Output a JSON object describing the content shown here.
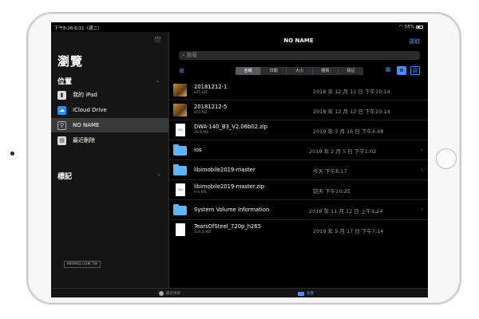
{
  "status": {
    "time": "下午8:26  6/11（週二）",
    "battery": "55%"
  },
  "sidebar": {
    "title": "瀏覽",
    "locations_label": "位置",
    "tags_label": "標記",
    "items": [
      {
        "label": "我的 iPad",
        "icon": "ipad-icon"
      },
      {
        "label": "iCloud Drive",
        "icon": "icloud-icon"
      },
      {
        "label": "NO NAME",
        "icon": "usb-icon"
      },
      {
        "label": "最近刪除",
        "icon": "trash-icon"
      }
    ],
    "watermark": "MRMAD.COM.TW"
  },
  "main": {
    "title": "NO NAME",
    "select_label": "選取",
    "search_placeholder": "搜尋",
    "sort_options": [
      "名稱",
      "日期",
      "大小",
      "種類",
      "標記"
    ],
    "files": [
      {
        "name": "20181212-1",
        "size": "845 KB",
        "date": "2018 年 12 月 12 日 下午10:14",
        "type": "img"
      },
      {
        "name": "20181212-5",
        "size": "855 KB",
        "date": "2018 年 12 月 12 日 下午10:14",
        "type": "img"
      },
      {
        "name": "DWA-140_B3_V2.06b02.zip",
        "size": "28.8 MB",
        "date": "2019 年 3 月 16 日 下午4:48",
        "type": "zip"
      },
      {
        "name": "ios",
        "size": "",
        "date": "2019 年 2 月 5 日 下午1:02",
        "type": "folder"
      },
      {
        "name": "libimobile2019-master",
        "size": "",
        "date": "今天 下午8:17",
        "type": "folder"
      },
      {
        "name": "libimobile2019-master.zip",
        "size": "9.6 MB",
        "date": "前天 下午10:25",
        "type": "zip"
      },
      {
        "name": "System Volume Information",
        "size": "",
        "date": "2018 年 11 月 12 日 上午9:24",
        "type": "folder"
      },
      {
        "name": "TearsOfSteel_720p_h265",
        "size": "105.8 MB",
        "date": "2019 年 5 月 17 日 下午7:14",
        "type": "doc"
      }
    ]
  },
  "tabbar": {
    "recent": "最近項目",
    "browse": "瀏覽"
  }
}
